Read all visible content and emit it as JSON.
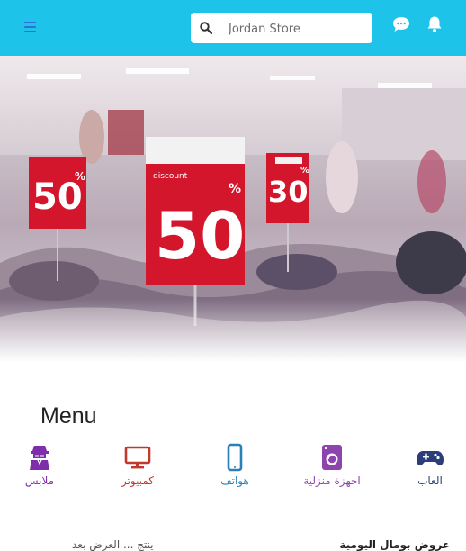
{
  "header": {
    "search_placeholder": "Jordan Store",
    "icons": [
      "menu-icon",
      "search-icon",
      "chat-icon",
      "bell-icon"
    ],
    "bg_color": "#1ec3ea"
  },
  "hero": {
    "signs": [
      {
        "text": "50",
        "sup": "%"
      },
      {
        "text": "50",
        "sup": "%",
        "small": "discount"
      },
      {
        "text": "30",
        "sup": "%"
      }
    ]
  },
  "menu": {
    "title": "Menu",
    "categories": [
      {
        "label": "العاب",
        "icon": "gamepad-icon",
        "color": "#2c3e7a"
      },
      {
        "label": "اجهزة منزلية",
        "icon": "washing-machine-icon",
        "color": "#8e44ad"
      },
      {
        "label": "هواتف",
        "icon": "phone-icon",
        "color": "#2980b9"
      },
      {
        "label": "كمبيوتر",
        "icon": "monitor-icon",
        "color": "#c0392b"
      },
      {
        "label": "ملابس",
        "icon": "clothes-icon",
        "color": "#7d2ea8"
      }
    ]
  },
  "offers": {
    "title": "عروض بومال اليومية",
    "subtitle": "ينتج ... العرض بعد"
  }
}
